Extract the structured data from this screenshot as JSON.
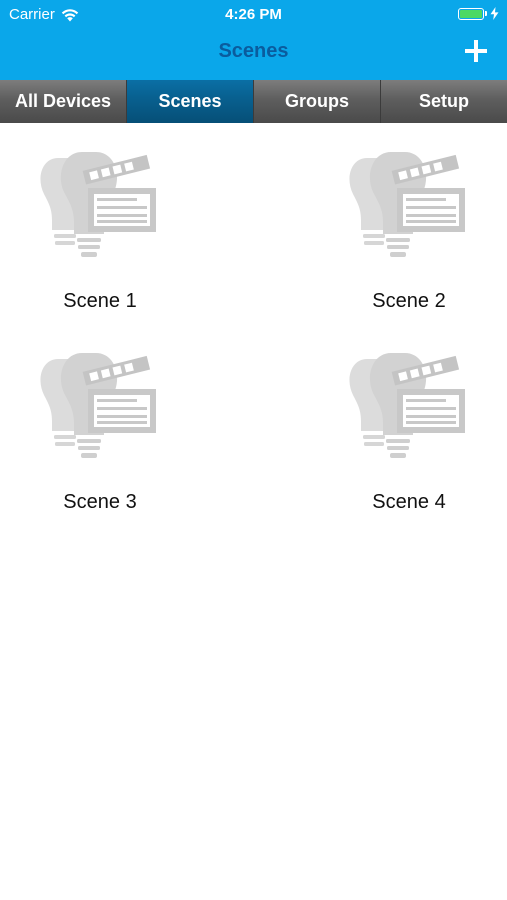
{
  "status_bar": {
    "carrier": "Carrier",
    "time": "4:26 PM",
    "battery_level": 1.0,
    "icons": [
      "wifi-icon",
      "battery-icon",
      "charging-bolt-icon"
    ]
  },
  "nav": {
    "title": "Scenes",
    "add_icon": "plus-icon",
    "background_color": "#0aa7ea",
    "title_color": "#0a5c9e"
  },
  "tabs": [
    {
      "label": "All Devices",
      "active": false
    },
    {
      "label": "Scenes",
      "active": true
    },
    {
      "label": "Groups",
      "active": false
    },
    {
      "label": "Setup",
      "active": false
    }
  ],
  "scenes": [
    {
      "label": "Scene 1",
      "icon": "scene-bulb-clapper-icon"
    },
    {
      "label": "Scene 2",
      "icon": "scene-bulb-clapper-icon"
    },
    {
      "label": "Scene 3",
      "icon": "scene-bulb-clapper-icon"
    },
    {
      "label": "Scene 4",
      "icon": "scene-bulb-clapper-icon"
    }
  ]
}
